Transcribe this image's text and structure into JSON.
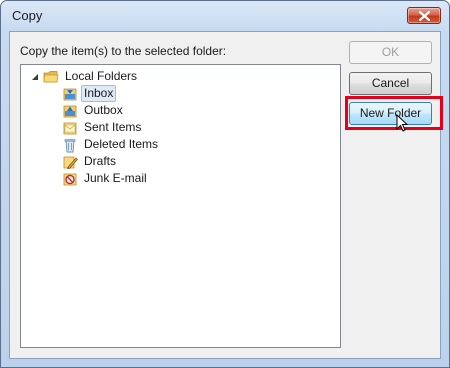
{
  "window": {
    "title": "Copy"
  },
  "prompt": "Copy the item(s) to the selected folder:",
  "tree": {
    "root": {
      "label": "Local Folders",
      "icon": "folder-icon",
      "expanded": true
    },
    "children": [
      {
        "label": "Inbox",
        "icon": "inbox-icon",
        "selected": true
      },
      {
        "label": "Outbox",
        "icon": "outbox-icon",
        "selected": false
      },
      {
        "label": "Sent Items",
        "icon": "sent-items-icon",
        "selected": false
      },
      {
        "label": "Deleted Items",
        "icon": "deleted-items-icon",
        "selected": false
      },
      {
        "label": "Drafts",
        "icon": "drafts-icon",
        "selected": false
      },
      {
        "label": "Junk E-mail",
        "icon": "junk-email-icon",
        "selected": false
      }
    ]
  },
  "buttons": {
    "ok": "OK",
    "cancel": "Cancel",
    "new_folder": "New Folder"
  },
  "colors": {
    "highlight": "#e3001b",
    "selection": "#dfeaf8",
    "close_button": "#c2391d"
  }
}
